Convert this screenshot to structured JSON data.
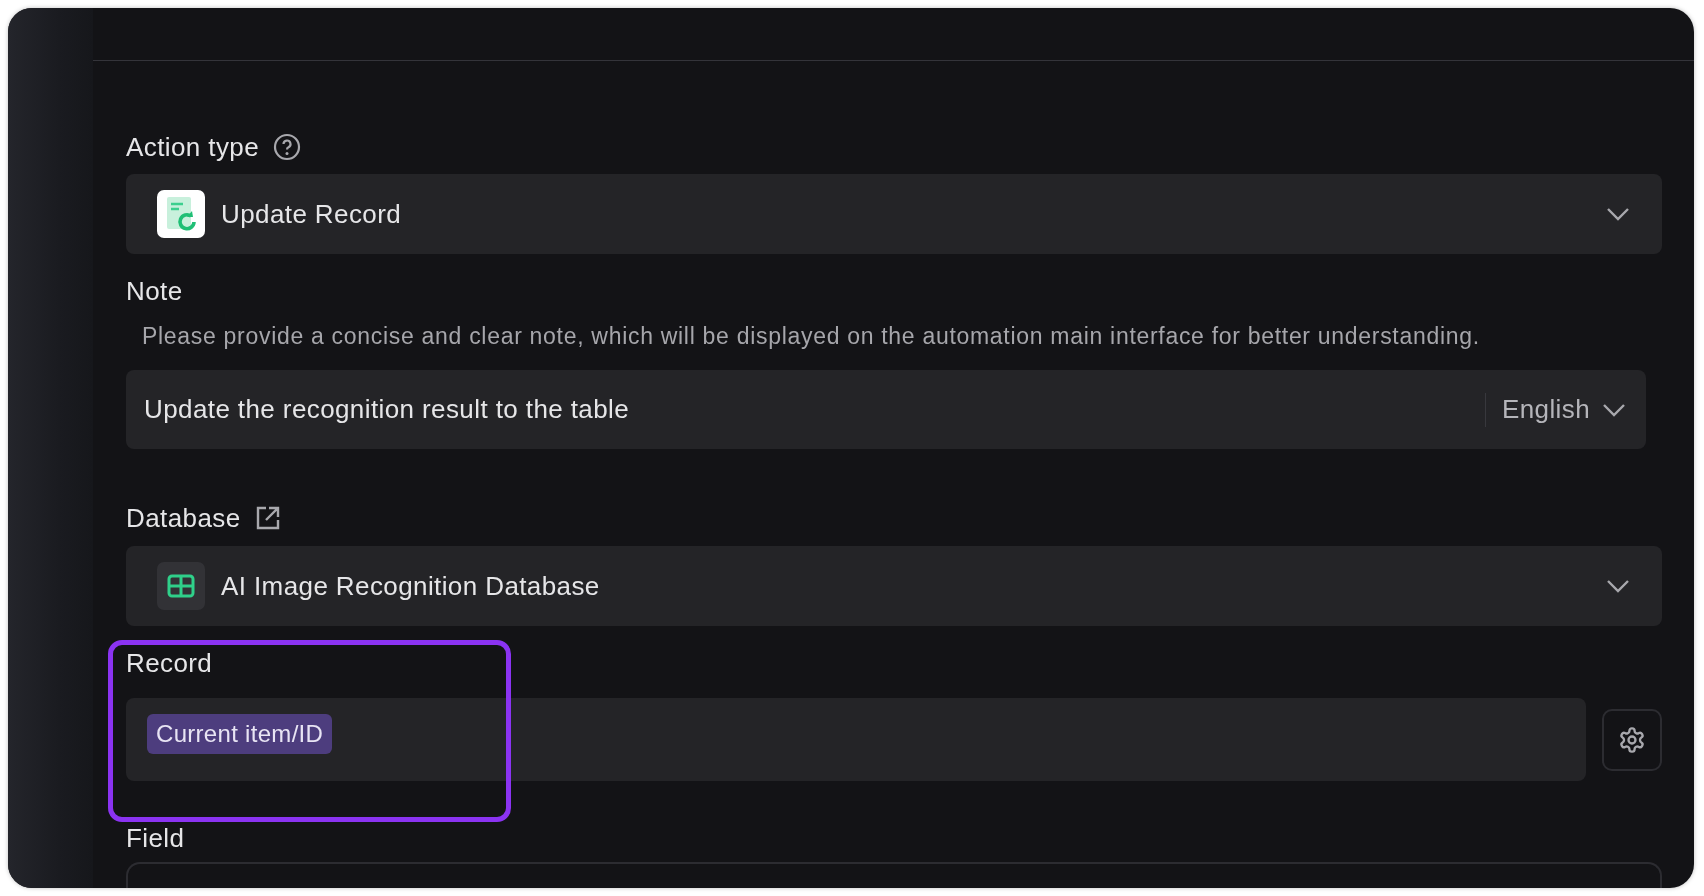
{
  "action_type": {
    "label": "Action type",
    "value": "Update Record"
  },
  "note": {
    "label": "Note",
    "hint": "Please provide a concise and clear note, which will be displayed on the automation main interface for better understanding.",
    "value": "Update the recognition result to the table",
    "language": "English"
  },
  "database": {
    "label": "Database",
    "value": "AI Image Recognition Database"
  },
  "record": {
    "label": "Record",
    "token": "Current item/ID",
    "highlighted": true
  },
  "field": {
    "label": "Field"
  }
}
